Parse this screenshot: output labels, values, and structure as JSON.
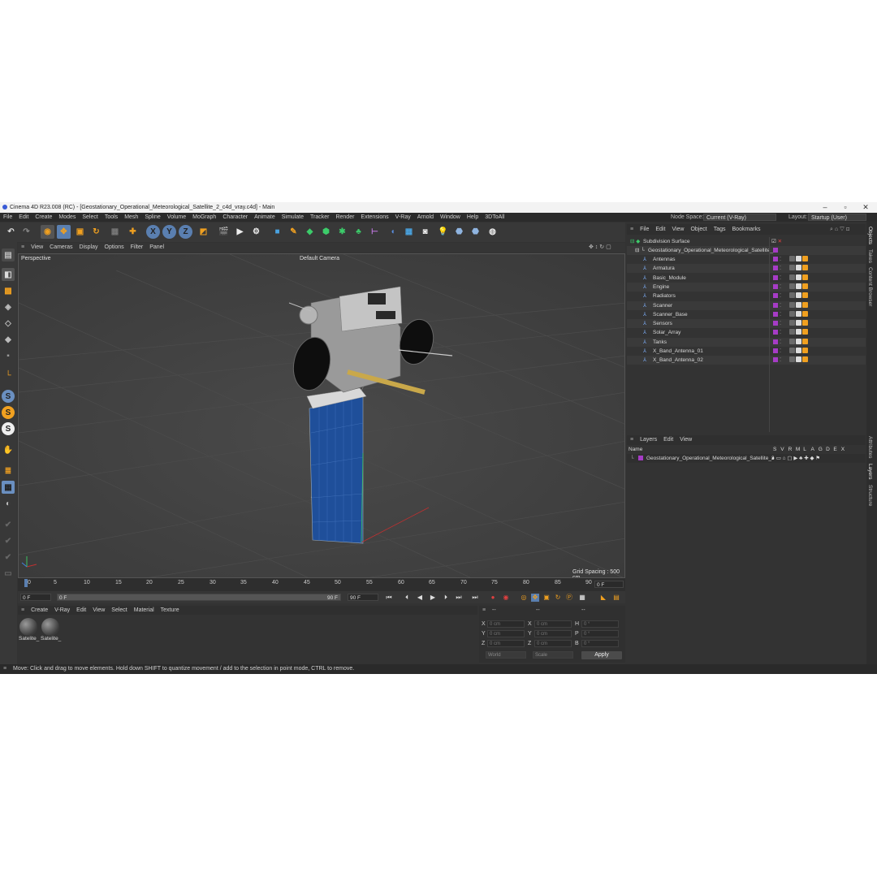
{
  "window": {
    "title": "Cinema 4D R23.008 (RC) - [Geostationary_Operational_Meteorological_Satellite_2_c4d_vray.c4d] - Main"
  },
  "menu": [
    "File",
    "Edit",
    "Create",
    "Modes",
    "Select",
    "Tools",
    "Mesh",
    "Spline",
    "Volume",
    "MoGraph",
    "Character",
    "Animate",
    "Simulate",
    "Tracker",
    "Render",
    "Extensions",
    "V-Ray",
    "Arnold",
    "Window",
    "Help",
    "3DToAll"
  ],
  "node_space": {
    "label": "Node Space:",
    "value": "Current (V-Ray)"
  },
  "layout": {
    "label": "Layout:",
    "value": "Startup (User)"
  },
  "toolbar": {
    "axis_x": "X",
    "axis_y": "Y",
    "axis_z": "Z"
  },
  "left_toolbar": {
    "s1": "S",
    "s2": "S",
    "s3": "S"
  },
  "viewport_menu": [
    "View",
    "Cameras",
    "Display",
    "Options",
    "Filter",
    "Panel"
  ],
  "viewport": {
    "name": "Perspective",
    "camera": "Default Camera",
    "grid_spacing": "Grid Spacing : 500 cm"
  },
  "timeline": {
    "ticks": [
      "0",
      "5",
      "10",
      "15",
      "20",
      "25",
      "30",
      "35",
      "40",
      "45",
      "50",
      "55",
      "60",
      "65",
      "70",
      "75",
      "80",
      "85",
      "90"
    ],
    "current_frame": "0 F",
    "start": "0 F",
    "range_start": "0 F",
    "range_end": "90 F",
    "end": "90 F"
  },
  "material_menu": [
    "Create",
    "V-Ray",
    "Edit",
    "View",
    "Select",
    "Material",
    "Texture"
  ],
  "materials": [
    "Satelite_",
    "Satelite_"
  ],
  "coordinates": {
    "dash1": "--",
    "dash2": "--",
    "dash3": "--",
    "rows": [
      {
        "a": "X",
        "av": "0 cm",
        "b": "X",
        "bv": "0 cm",
        "c": "H",
        "cv": "0 °"
      },
      {
        "a": "Y",
        "av": "0 cm",
        "b": "Y",
        "bv": "0 cm",
        "c": "P",
        "cv": "0 °"
      },
      {
        "a": "Z",
        "av": "0 cm",
        "b": "Z",
        "bv": "0 cm",
        "c": "B",
        "cv": "0 °"
      }
    ],
    "mode": "World",
    "type": "Scale",
    "apply": "Apply"
  },
  "object_menu": [
    "File",
    "Edit",
    "View",
    "Object",
    "Tags",
    "Bookmarks"
  ],
  "objects": {
    "root": "Subdivision Surface",
    "group": "Geostationary_Operational_Meteorological_Satellite_2",
    "children": [
      "Antennas",
      "Armatura",
      "Basic_Module",
      "Engine",
      "Radiators",
      "Scanner",
      "Scanner_Base",
      "Sensors",
      "Solar_Array",
      "Tanks",
      "X_Band_Antenna_01",
      "X_Band_Antenna_02"
    ]
  },
  "layer_menu": [
    "Layers",
    "Edit",
    "View"
  ],
  "layers": {
    "name_header": "Name",
    "columns": [
      "S",
      "V",
      "R",
      "M",
      "L",
      "A",
      "G",
      "D",
      "E",
      "X"
    ],
    "rows": [
      "Geostationary_Operational_Meteorological_Satellite_2"
    ]
  },
  "side_tabs": [
    "Objects",
    "Takes",
    "Content Browser",
    "Attributes",
    "Layers",
    "Structure"
  ],
  "status": "Move: Click and drag to move elements. Hold down SHIFT to quantize movement / add to the selection in point mode, CTRL to remove.",
  "colors": {
    "accent": "#f0a020",
    "layer": "#a63cc6",
    "solar": "#1f4f9a"
  }
}
